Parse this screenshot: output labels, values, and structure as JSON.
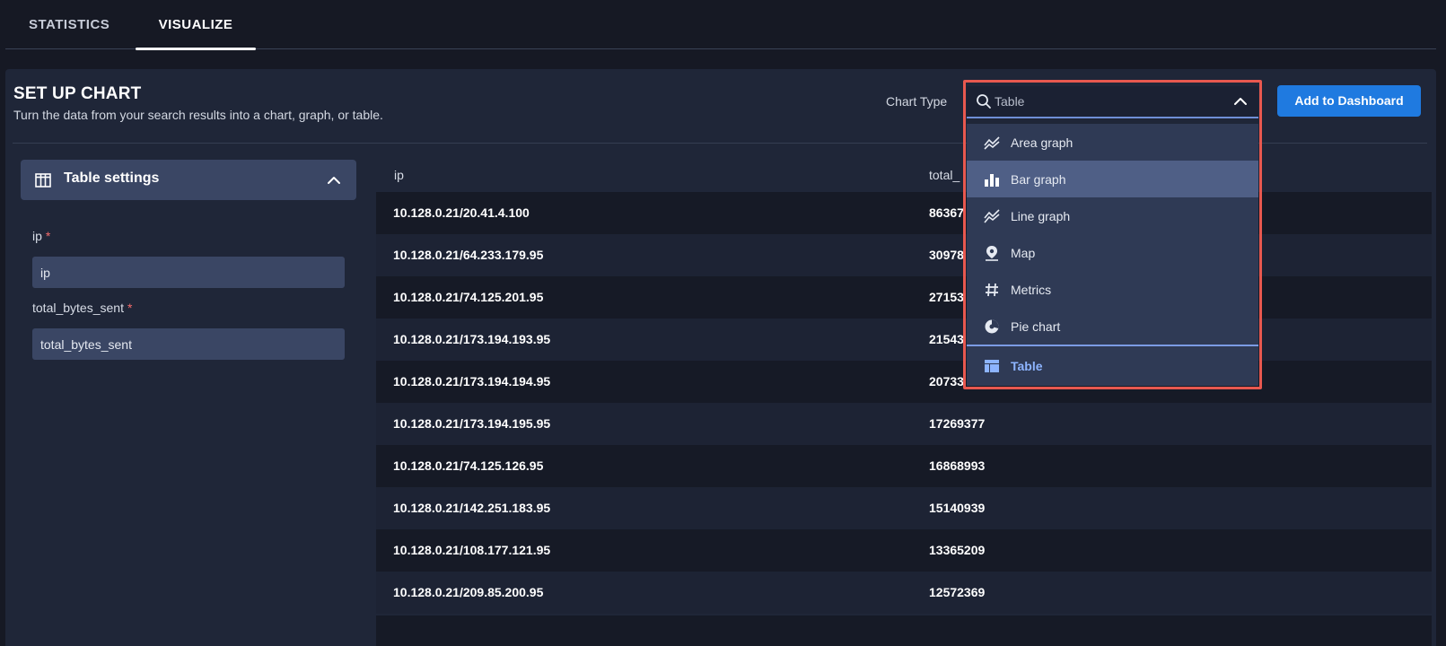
{
  "tabs": [
    {
      "label": "STATISTICS"
    },
    {
      "label": "VISUALIZE"
    }
  ],
  "panel": {
    "title": "SET UP CHART",
    "subtitle": "Turn the data from your search results into a chart, graph, or table.",
    "chart_type_label": "Chart Type",
    "add_button": "Add to Dashboard"
  },
  "combo": {
    "placeholder": "Table",
    "options": [
      {
        "label": "Area graph",
        "icon": "area-graph-icon"
      },
      {
        "label": "Bar graph",
        "icon": "bar-graph-icon"
      },
      {
        "label": "Line graph",
        "icon": "line-graph-icon"
      },
      {
        "label": "Map",
        "icon": "map-pin-icon"
      },
      {
        "label": "Metrics",
        "icon": "hash-icon"
      },
      {
        "label": "Pie chart",
        "icon": "pie-chart-icon"
      },
      {
        "label": "Table",
        "icon": "table-icon"
      }
    ],
    "hovered": "Bar graph",
    "selected": "Table"
  },
  "settings": {
    "title": "Table settings",
    "fields": [
      {
        "label": "ip",
        "required_mark": "*",
        "value": "ip"
      },
      {
        "label": "total_bytes_sent",
        "required_mark": "*",
        "value": "total_bytes_sent"
      }
    ]
  },
  "table": {
    "columns": [
      "ip",
      "total_"
    ],
    "rows": [
      {
        "ip": "10.128.0.21/20.41.4.100",
        "bytes": "86367"
      },
      {
        "ip": "10.128.0.21/64.233.179.95",
        "bytes": "30978"
      },
      {
        "ip": "10.128.0.21/74.125.201.95",
        "bytes": "27153"
      },
      {
        "ip": "10.128.0.21/173.194.193.95",
        "bytes": "21543"
      },
      {
        "ip": "10.128.0.21/173.194.194.95",
        "bytes": "20733"
      },
      {
        "ip": "10.128.0.21/173.194.195.95",
        "bytes": "17269377"
      },
      {
        "ip": "10.128.0.21/74.125.126.95",
        "bytes": "16868993"
      },
      {
        "ip": "10.128.0.21/142.251.183.95",
        "bytes": "15140939"
      },
      {
        "ip": "10.128.0.21/108.177.121.95",
        "bytes": "13365209"
      },
      {
        "ip": "10.128.0.21/209.85.200.95",
        "bytes": "12572369"
      }
    ]
  },
  "colors": {
    "accent": "#1f7ae0",
    "highlight": "#e8584f",
    "selected_text": "#8db4ff",
    "hover_bg": "#4f5f86"
  }
}
